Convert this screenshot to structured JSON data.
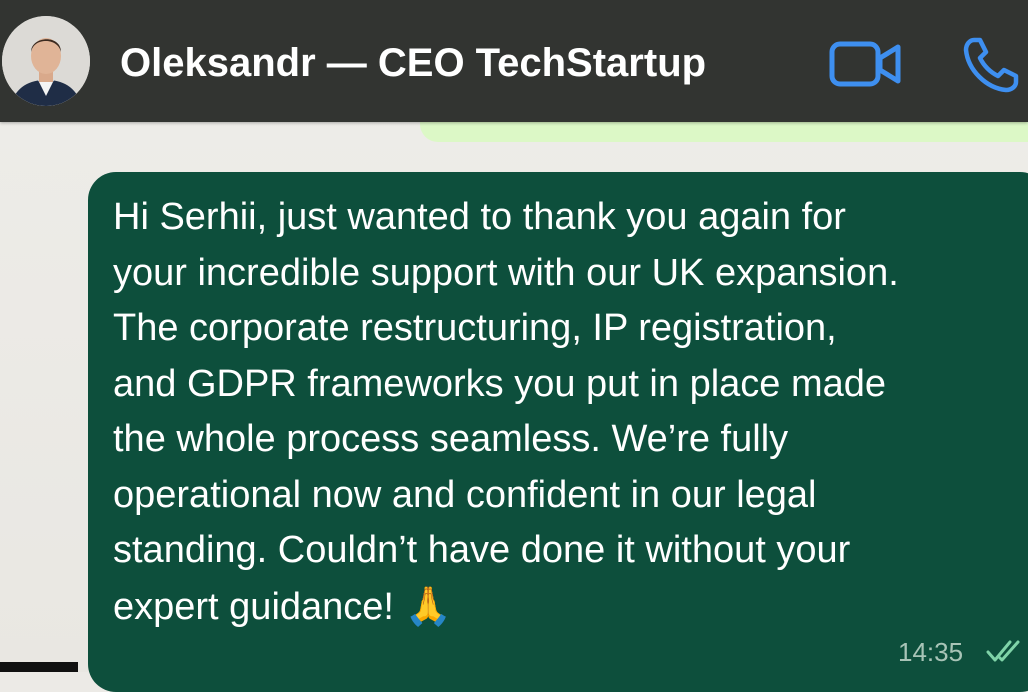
{
  "header": {
    "contact_name": "Oleksandr — CEO TechStartup",
    "avatar_icon": "contact-avatar",
    "video_icon": "video-camera-icon",
    "call_icon": "phone-icon"
  },
  "message": {
    "text": "Hi Serhii, just wanted to thank you again for\nyour incredible support with our UK expansion.\nThe corporate restructuring, IP registration,\nand GDPR frameworks you put in place made\nthe whole process seamless. We’re fully\noperational now and confident in our legal\nstanding. Couldn’t have done it without your\nexpert guidance! ",
    "emoji": "🙏",
    "time": "14:35",
    "status_icon": "double-check-icon"
  },
  "colors": {
    "header_bg": "#323431",
    "bubble_bg": "#0d4f3c",
    "accent_icons": "#3e8ff0",
    "prev_bubble": "#dcf8c6",
    "chat_bg": "#eceae6"
  }
}
